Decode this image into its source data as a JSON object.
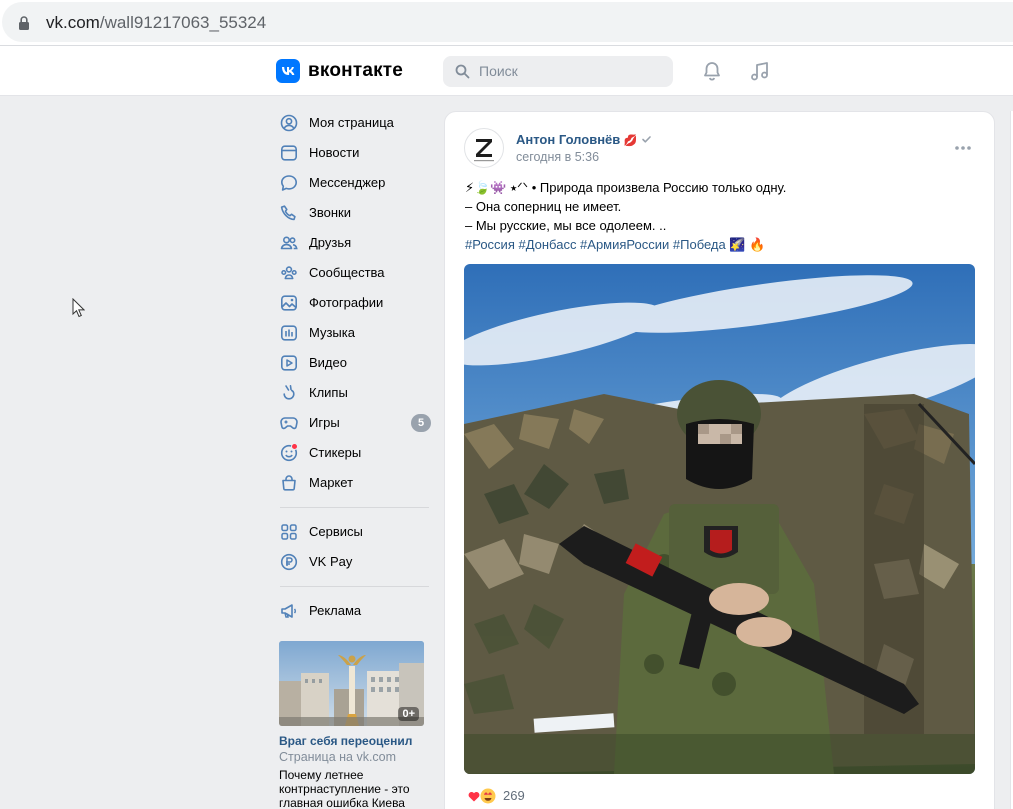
{
  "browser": {
    "url_domain": "vk.com",
    "url_path": "/wall91217063_55324"
  },
  "header": {
    "logo_text": "вконтакте",
    "search_placeholder": "Поиск"
  },
  "menu": {
    "items": [
      {
        "label": "Моя страница",
        "icon": "user-icon"
      },
      {
        "label": "Новости",
        "icon": "news-icon"
      },
      {
        "label": "Мессенджер",
        "icon": "chat-icon"
      },
      {
        "label": "Звонки",
        "icon": "phone-icon"
      },
      {
        "label": "Друзья",
        "icon": "friends-icon"
      },
      {
        "label": "Сообщества",
        "icon": "groups-icon"
      },
      {
        "label": "Фотографии",
        "icon": "photo-icon"
      },
      {
        "label": "Музыка",
        "icon": "music-icon"
      },
      {
        "label": "Видео",
        "icon": "video-icon"
      },
      {
        "label": "Клипы",
        "icon": "clips-icon"
      },
      {
        "label": "Игры",
        "icon": "games-icon",
        "badge": "5"
      },
      {
        "label": "Стикеры",
        "icon": "stickers-icon"
      },
      {
        "label": "Маркет",
        "icon": "market-icon"
      }
    ],
    "group2": [
      {
        "label": "Сервисы",
        "icon": "services-icon"
      },
      {
        "label": "VK Pay",
        "icon": "vkpay-icon"
      }
    ],
    "group3": [
      {
        "label": "Реклама",
        "icon": "ads-icon"
      }
    ]
  },
  "ad": {
    "age": "0+",
    "title": "Враг себя переоценил",
    "subtitle": "Страница на vk.com",
    "description": "Почему летнее контрнаступление - это главная ошибка Киева"
  },
  "post": {
    "author": "Антон Головнёв",
    "time": "сегодня в 5:36",
    "line1_emoji": "⚡🍃👾 ⭑ᐟᐠ",
    "line1_text": " • Природа произвела Россию только одну.",
    "line2": "– Она соперниц не имеет.",
    "line3": "– Мы русские, мы все одолеем. ..",
    "hashtags": "#Россия #Донбасс #АрмияРоссии #Победа",
    "hashtag_emoji": "🌠 🔥",
    "reactions_count": "269"
  },
  "colors": {
    "accent": "#0077ff",
    "link": "#2a5885",
    "muted": "#818c99",
    "page_bg": "#edeef0"
  }
}
